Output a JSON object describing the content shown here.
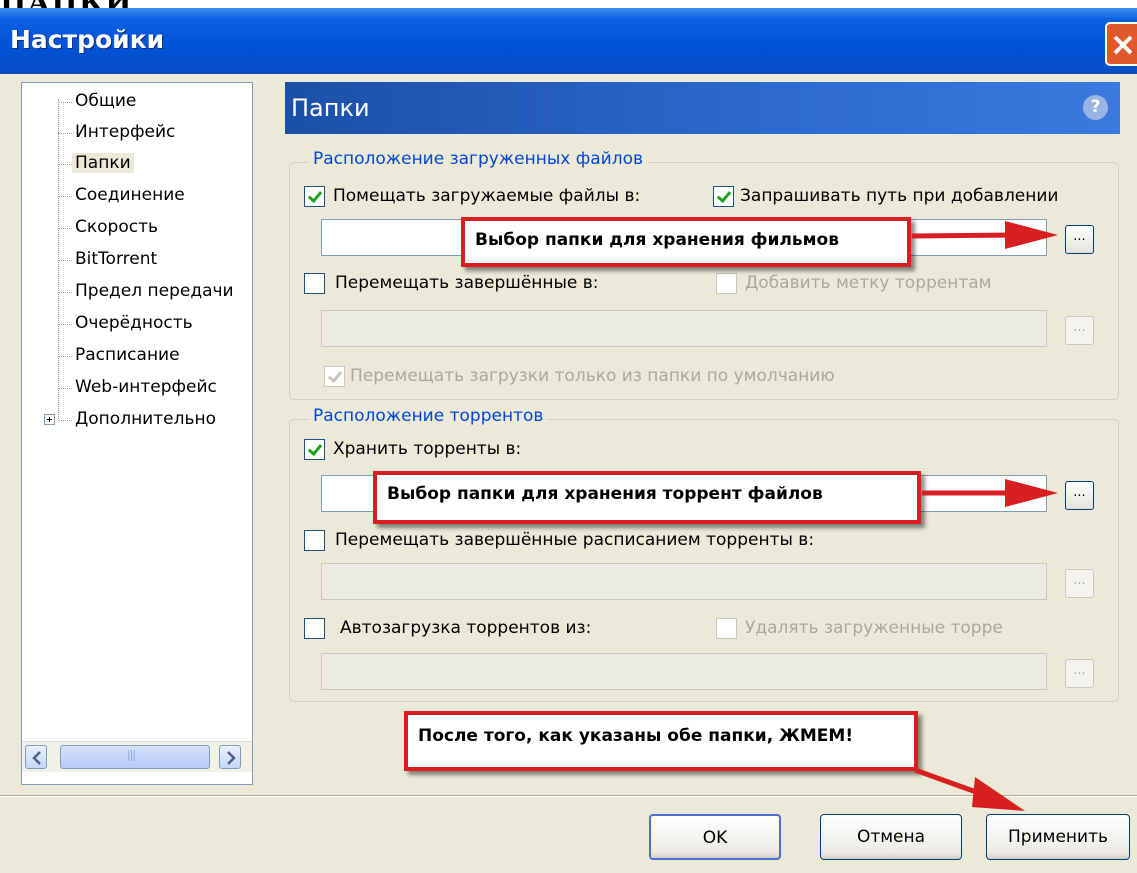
{
  "page_caption": "ПАПКИ",
  "window": {
    "title": "Настройки"
  },
  "tree": {
    "items": [
      {
        "label": "Общие"
      },
      {
        "label": "Интерфейс"
      },
      {
        "label": "Папки"
      },
      {
        "label": "Соединение"
      },
      {
        "label": "Скорость"
      },
      {
        "label": "BitTorrent"
      },
      {
        "label": "Предел передачи"
      },
      {
        "label": "Очерёдность"
      },
      {
        "label": "Расписание"
      },
      {
        "label": "Web-интерфейс"
      },
      {
        "label": "Дополнительно"
      }
    ],
    "selected": "Папки"
  },
  "section": {
    "title": "Папки",
    "help": "?"
  },
  "downloads_group": {
    "title": "Расположение загруженных файлов",
    "put_downloads": {
      "label": "Помещать загружаемые файлы в:",
      "checked": true,
      "value": ""
    },
    "ask_path": {
      "label": "Запрашивать путь при добавлении",
      "checked": true
    },
    "move_completed": {
      "label": "Перемещать завершённые в:",
      "checked": false,
      "value": ""
    },
    "add_label": {
      "label": "Добавить метку торрентам",
      "checked": false
    },
    "only_default": {
      "label": "Перемещать загрузки только из папки по умолчанию",
      "checked": true
    }
  },
  "torrents_group": {
    "title": "Расположение торрентов",
    "store_torrents": {
      "label": "Хранить торренты в:",
      "checked": true,
      "value": ""
    },
    "move_scheduled": {
      "label": "Перемещать завершённые расписанием торренты в:",
      "checked": false,
      "value": ""
    },
    "autoload": {
      "label": "Автозагрузка торрентов из:",
      "checked": false,
      "value": ""
    },
    "delete_loaded": {
      "label": "Удалять загруженные торре",
      "checked": false
    }
  },
  "browse_label": "...",
  "callouts": {
    "movies": "Выбор папки для хранения фильмов",
    "torrents": "Выбор папки для хранения торрент файлов",
    "apply": "После того, как указаны обе папки, ЖМЕМ!"
  },
  "buttons": {
    "ok": "OK",
    "cancel": "Отмена",
    "apply": "Применить"
  },
  "colors": {
    "titlebar": "#0052d6",
    "annotation": "#d71f1f",
    "group_title": "#0046d5"
  }
}
